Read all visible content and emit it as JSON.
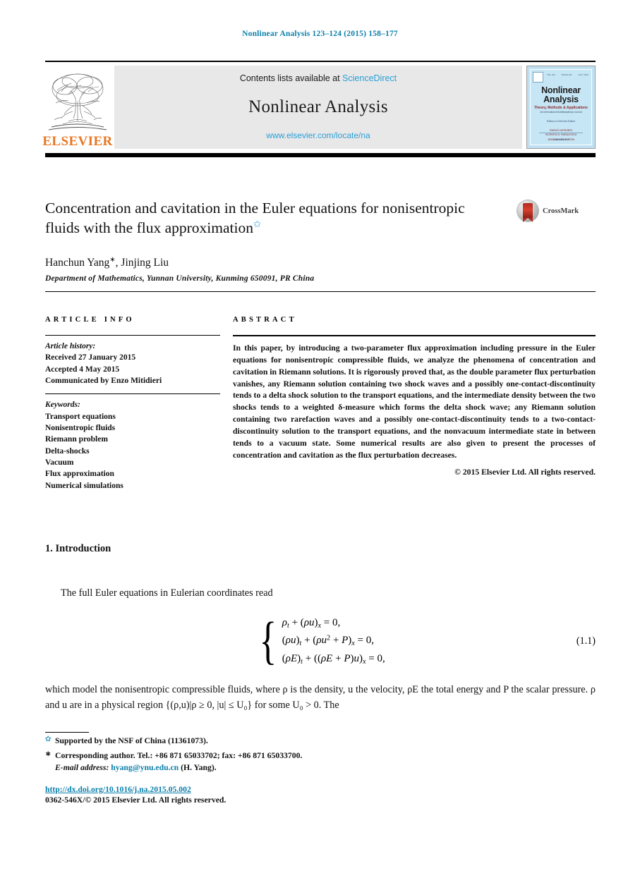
{
  "running_head": "Nonlinear Analysis 123–124 (2015) 158–177",
  "masthead": {
    "contents_prefix": "Contents lists available at ",
    "sciencedirect": "ScienceDirect",
    "journal_title": "Nonlinear Analysis",
    "journal_url": "www.elsevier.com/locate/na",
    "publisher_wordmark": "ELSEVIER",
    "cover": {
      "title_line1": "Nonlinear",
      "title_line2": "Analysis",
      "subtitle": "Theory, Methods & Applications",
      "subtitle2": "An International Multidisciplinary Journal",
      "editors_label": "Editors-in-Chief and Editors",
      "editor1": "ENRICO MITIDIERI",
      "editor2": "VICENTIU D. RADULESCU",
      "editor3": "JEAN-MICHEL CORON",
      "footer": "ScienceDirect"
    }
  },
  "article": {
    "title": "Concentration and cavitation in the Euler equations for nonisentropic fluids with the flux approximation",
    "title_footnote_mark": "✩",
    "authors": "Hanchun Yang",
    "author_corr_mark": "∗",
    "authors_rest": ", Jinjing Liu",
    "affiliation": "Department of Mathematics, Yunnan University, Kunming 650091, PR China",
    "crossmark_label": "CrossMark"
  },
  "info": {
    "heading": "ARTICLE INFO",
    "history_label": "Article history:",
    "history": [
      "Received 27 January 2015",
      "Accepted 4 May 2015",
      "Communicated by Enzo Mitidieri"
    ],
    "keywords_label": "Keywords:",
    "keywords": [
      "Transport equations",
      "Nonisentropic fluids",
      "Riemann problem",
      "Delta-shocks",
      "Vacuum",
      "Flux approximation",
      "Numerical simulations"
    ]
  },
  "abstract": {
    "heading": "ABSTRACT",
    "text": "In this paper, by introducing a two-parameter flux approximation including pressure in the Euler equations for nonisentropic compressible fluids, we analyze the phenomena of concentration and cavitation in Riemann solutions. It is rigorously proved that, as the double parameter flux perturbation vanishes, any Riemann solution containing two shock waves and a possibly one-contact-discontinuity tends to a delta shock solution to the transport equations, and the intermediate density between the two shocks tends to a weighted δ-measure which forms the delta shock wave; any Riemann solution containing two rarefaction waves and a possibly one-contact-discontinuity tends to a two-contact-discontinuity solution to the transport equations, and the nonvacuum intermediate state in between tends to a vacuum state. Some numerical results are also given to present the processes of concentration and cavitation as the flux perturbation decreases.",
    "copyright": "© 2015 Elsevier Ltd. All rights reserved."
  },
  "body": {
    "section_heading": "1. Introduction",
    "intro_paragraph": "The full Euler equations in Eulerian coordinates read",
    "equation": {
      "number": "(1.1)",
      "line1": "ρt + (ρu)x = 0,",
      "line2": "(ρu)t + (ρu² + P)x = 0,",
      "line3": "(ρE)t + ((ρE + P)u)x = 0,"
    },
    "after_equation": "which model the nonisentropic compressible fluids, where ρ is the density, u the velocity, ρE the total energy and P the scalar pressure. ρ and u are in a physical region {(ρ,u)|ρ ≥ 0, |u| ≤ U₀} for  some U₀ > 0. The"
  },
  "footnotes": {
    "support_mark": "✩",
    "support": "Supported by the NSF of China (11361073).",
    "corresponding_mark": "∗",
    "corresponding": "Corresponding author. Tel.: +86 871 65033702; fax: +86 871 65033700.",
    "email_label": "E-mail address:",
    "email": "hyang@ynu.edu.cn",
    "email_suffix": "(H. Yang)."
  },
  "bottom": {
    "doi": "http://dx.doi.org/10.1016/j.na.2015.05.002",
    "issn": "0362-546X/© 2015 Elsevier Ltd. All rights reserved."
  },
  "colors": {
    "link_blue": "#0b7fab",
    "sd_blue": "#2a9fd6",
    "elsevier_orange": "#E87722",
    "cover_bg": "#bfe0f2"
  }
}
